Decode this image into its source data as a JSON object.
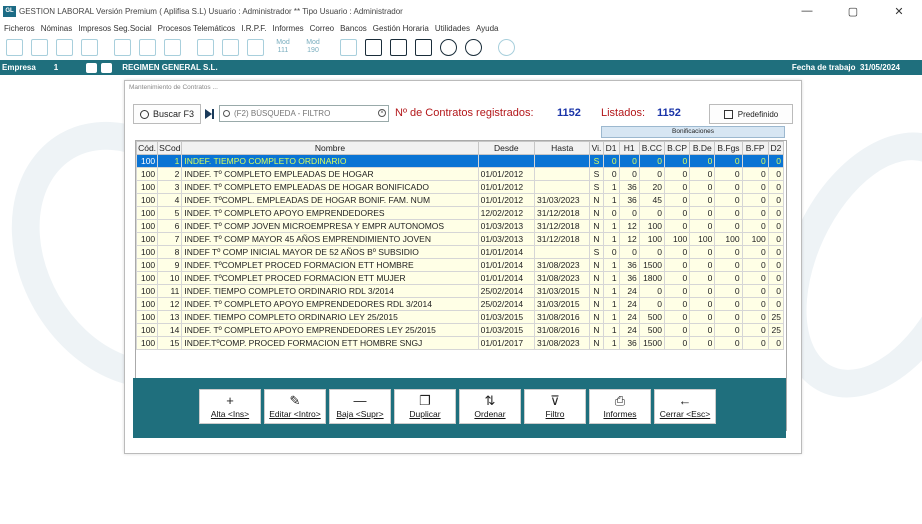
{
  "window": {
    "app_icon": "GL",
    "title": "GESTION LABORAL Versión Premium ( Aplifisa S.L)   Usuario : Administrador  **  Tipo Usuario : Administrador",
    "minimize": "—",
    "maximize": "▢",
    "close": "✕"
  },
  "menu": [
    "Ficheros",
    "Nóminas",
    "Impresos Seg.Social",
    "Procesos Telemáticos",
    "I.R.P.F.",
    "Informes",
    "Correo",
    "Bancos",
    "Gestión Horaria",
    "Utilidades",
    "Ayuda"
  ],
  "toolbar": {
    "mod111": "Mod\n111",
    "mod190": "Mod\n190"
  },
  "empresa": {
    "label": "Empresa",
    "number": "1",
    "regimen": "REGIMEN GENERAL  S.L.",
    "fecha_label": "Fecha de trabajo",
    "fecha": "31/05/2024"
  },
  "dialog": {
    "title": "Mantenimiento de Contratos ...",
    "buscar_label": "Buscar F3",
    "search_placeholder": "(F2) BÚSQUEDA - FILTRO",
    "registered_label": "Nº de Contratos registrados:",
    "registered_count": "1152",
    "listed_label": "Listados:",
    "listed_count": "1152",
    "predefinido_label": "Predefinido",
    "bonificaciones_label": "Bonificaciones",
    "footer_mark": "—"
  },
  "table": {
    "columns": [
      "Cód.",
      "SCod",
      "Nombre",
      "Desde",
      "Hasta",
      "Vi.",
      "D1",
      "H1",
      "B.CC",
      "B.CP",
      "B.De",
      "B.Fgs",
      "B.FP",
      "D2"
    ],
    "rows": [
      [
        "100",
        "1",
        "INDEF. TIEMPO COMPLETO ORDINARIO",
        "",
        "",
        "S",
        "0",
        "0",
        "0",
        "0",
        "0",
        "0",
        "0",
        "0"
      ],
      [
        "100",
        "2",
        "INDEF. Tº COMPLETO EMPLEADAS DE HOGAR",
        "01/01/2012",
        "",
        "S",
        "0",
        "0",
        "0",
        "0",
        "0",
        "0",
        "0",
        "0"
      ],
      [
        "100",
        "3",
        "INDEF. Tº COMPLETO EMPLEADAS DE HOGAR BONIFICADO",
        "01/01/2012",
        "",
        "S",
        "1",
        "36",
        "20",
        "0",
        "0",
        "0",
        "0",
        "0"
      ],
      [
        "100",
        "4",
        "INDEF. TºCOMPL. EMPLEADAS DE HOGAR BONIF. FAM. NUM",
        "01/01/2012",
        "31/03/2023",
        "N",
        "1",
        "36",
        "45",
        "0",
        "0",
        "0",
        "0",
        "0"
      ],
      [
        "100",
        "5",
        "INDEF. Tº COMPLETO APOYO EMPRENDEDORES",
        "12/02/2012",
        "31/12/2018",
        "N",
        "0",
        "0",
        "0",
        "0",
        "0",
        "0",
        "0",
        "0"
      ],
      [
        "100",
        "6",
        "INDEF. Tº COMP JOVEN MICROEMPRESA Y EMPR AUTONOMOS",
        "01/03/2013",
        "31/12/2018",
        "N",
        "1",
        "12",
        "100",
        "0",
        "0",
        "0",
        "0",
        "0"
      ],
      [
        "100",
        "7",
        "INDEF. Tº COMP MAYOR 45 AÑOS EMPRENDIMIENTO JOVEN",
        "01/03/2013",
        "31/12/2018",
        "N",
        "1",
        "12",
        "100",
        "100",
        "100",
        "100",
        "100",
        "0"
      ],
      [
        "100",
        "8",
        "INDEF Tº COMP INICIAL MAYOR DE 52 AÑOS Bº SUBSIDIO",
        "01/01/2014",
        "",
        "S",
        "0",
        "0",
        "0",
        "0",
        "0",
        "0",
        "0",
        "0"
      ],
      [
        "100",
        "9",
        "INDEF. TºCOMPLET PROCED FORMACION ETT HOMBRE",
        "01/01/2014",
        "31/08/2023",
        "N",
        "1",
        "36",
        "1500",
        "0",
        "0",
        "0",
        "0",
        "0"
      ],
      [
        "100",
        "10",
        "INDEF. TºCOMPLET PROCED FORMACION ETT MUJER",
        "01/01/2014",
        "31/08/2023",
        "N",
        "1",
        "36",
        "1800",
        "0",
        "0",
        "0",
        "0",
        "0"
      ],
      [
        "100",
        "11",
        "INDEF. TIEMPO COMPLETO ORDINARIO RDL 3/2014",
        "25/02/2014",
        "31/03/2015",
        "N",
        "1",
        "24",
        "0",
        "0",
        "0",
        "0",
        "0",
        "0"
      ],
      [
        "100",
        "12",
        "INDEF. Tº COMPLETO APOYO EMPRENDEDORES RDL 3/2014",
        "25/02/2014",
        "31/03/2015",
        "N",
        "1",
        "24",
        "0",
        "0",
        "0",
        "0",
        "0",
        "0"
      ],
      [
        "100",
        "13",
        "INDEF. TIEMPO COMPLETO ORDINARIO LEY 25/2015",
        "01/03/2015",
        "31/08/2016",
        "N",
        "1",
        "24",
        "500",
        "0",
        "0",
        "0",
        "0",
        "25"
      ],
      [
        "100",
        "14",
        "INDEF. Tº COMPLETO APOYO EMPRENDEDORES LEY 25/2015",
        "01/03/2015",
        "31/08/2016",
        "N",
        "1",
        "24",
        "500",
        "0",
        "0",
        "0",
        "0",
        "25"
      ],
      [
        "100",
        "15",
        "INDEF.TºCOMP. PROCED FORMACION ETT HOMBRE SNGJ",
        "01/01/2017",
        "31/08/2023",
        "N",
        "1",
        "36",
        "1500",
        "0",
        "0",
        "0",
        "0",
        "0"
      ]
    ]
  },
  "actions": [
    {
      "icon": "+",
      "label": "Alta <Ins>",
      "name": "alta-button",
      "icon_name": "plus-icon"
    },
    {
      "icon": "✎",
      "label": "Editar <Intro>",
      "name": "editar-button",
      "icon_name": "pencil-icon"
    },
    {
      "icon": "—",
      "label": "Baja <Supr>",
      "name": "baja-button",
      "icon_name": "minus-icon"
    },
    {
      "icon": "❐",
      "label": "Duplicar",
      "name": "duplicar-button",
      "icon_name": "copy-icon"
    },
    {
      "icon": "⇅",
      "label": "Ordenar",
      "name": "ordenar-button",
      "icon_name": "sort-icon"
    },
    {
      "icon": "⊽",
      "label": "Filtro",
      "name": "filtro-button",
      "icon_name": "filter-icon"
    },
    {
      "icon": "⎙",
      "label": "Informes",
      "name": "informes-button",
      "icon_name": "printer-icon"
    },
    {
      "icon": "←",
      "label": "Cerrar <Esc>",
      "name": "cerrar-button",
      "icon_name": "arrow-left-icon"
    }
  ],
  "colors": {
    "accent": "#1f6f7d",
    "selection": "#0a74d4",
    "row_bg": "#ffffe6",
    "label_red": "#b3171a",
    "count_blue": "#1a34a8"
  }
}
